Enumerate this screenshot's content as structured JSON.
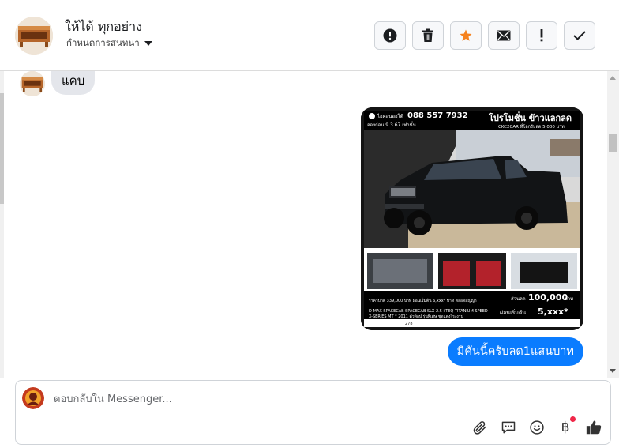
{
  "header": {
    "contact_name": "ให้ได้ ทุกอย่าง",
    "conversation_settings": "กำหนดการสนทนา",
    "toolbar": [
      {
        "name": "report-button",
        "icon": "alert-circle-icon"
      },
      {
        "name": "delete-button",
        "icon": "trash-icon"
      },
      {
        "name": "star-button",
        "icon": "star-icon"
      },
      {
        "name": "mail-button",
        "icon": "envelope-icon"
      },
      {
        "name": "important-button",
        "icon": "exclamation-icon"
      },
      {
        "name": "done-button",
        "icon": "checkmark-icon"
      }
    ]
  },
  "thread": {
    "incoming_text": "แคบ",
    "outgoing_text": "มีคันนี้ครับลด1แสนบาท",
    "photo": {
      "brand": "ไอคอนออโต้",
      "phone": "088 557 7932",
      "headline": "โปรโมชั่น ข้าวแลกลด",
      "sub_headline": "CKC2CAR ที่โลกรับลด 5,000 บาท",
      "booking": "จองก่อน 9.3.67 เท่านั้น",
      "price_line": "ราคาปกติ 339,000 บาท ผ่อนเริ่มต้น 6,xxx* บาท ตลอดสัญญา",
      "discount_label": "ส่วนลด",
      "discount_value": "100,000",
      "discount_unit": "บาท",
      "installment_label": "ผ่อนเริ่มต้น",
      "installment_value": "5,xxx*",
      "model_line1": "D-MAX SPACECAB SPACECAB SLX 2.5 i-TEQ TITANIUM SPEED",
      "model_line2": "X-SERIES MT * 2011 ตัวท็อป รุ่นพิเศษ ชุดแต่งโรงงาน",
      "code": "278"
    }
  },
  "composer": {
    "placeholder": "ตอบกลับใน Messenger...",
    "value": "",
    "icons": [
      "paperclip-icon",
      "comment-icon",
      "emoji-icon",
      "baht-icon",
      "thumbs-up-icon"
    ],
    "baht_symbol": "฿"
  },
  "colors": {
    "accent": "#0a7cff",
    "star": "#f5821f",
    "incoming_bubble": "#e4e6eb",
    "notif": "#f02849"
  }
}
